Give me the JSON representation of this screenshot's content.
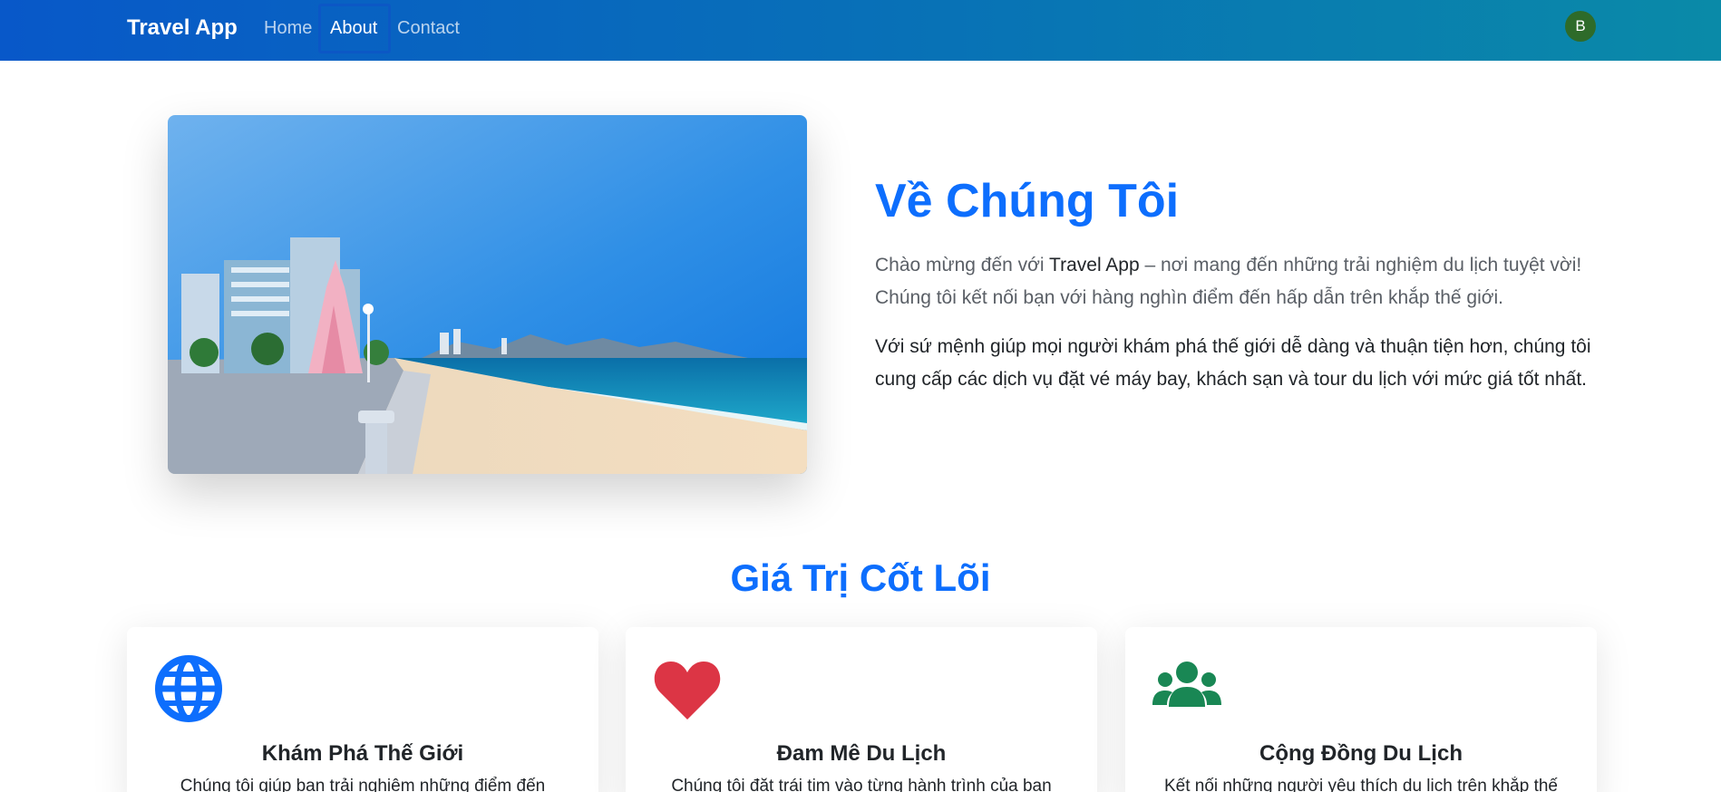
{
  "navbar": {
    "brand": "Travel App",
    "links": [
      {
        "label": "Home",
        "active": false
      },
      {
        "label": "About",
        "active": true
      },
      {
        "label": "Contact",
        "active": false
      }
    ],
    "avatar_initial": "B",
    "gradient": [
      "#0858c9",
      "#0a8aa8"
    ]
  },
  "hero": {
    "image_icon": "beach-city-photo",
    "title": "Về Chúng Tôi",
    "lead_prefix": "Chào mừng đến với ",
    "lead_app_name": "Travel App",
    "lead_suffix": " – nơi mang đến những trải nghiệm du lịch tuyệt vời! Chúng tôi kết nối bạn với hàng nghìn điểm đến hấp dẫn trên khắp thế giới.",
    "body": "Với sứ mệnh giúp mọi người khám phá thế giới dễ dàng và thuận tiện hơn, chúng tôi cung cấp các dịch vụ đặt vé máy bay, khách sạn và tour du lịch với mức giá tốt nhất."
  },
  "core_values": {
    "title": "Giá Trị Cốt Lõi",
    "cards": [
      {
        "icon": "globe-icon",
        "icon_color": "#0d6efd",
        "title": "Khám Phá Thế Giới",
        "text": "Chúng tôi giúp bạn trải nghiệm những điểm đến"
      },
      {
        "icon": "heart-icon",
        "icon_color": "#dc3545",
        "title": "Đam Mê Du Lịch",
        "text": "Chúng tôi đặt trái tim vào từng hành trình của bạn"
      },
      {
        "icon": "users-icon",
        "icon_color": "#198754",
        "title": "Cộng Đồng Du Lịch",
        "text": "Kết nối những người yêu thích du lịch trên khắp thế"
      }
    ]
  },
  "colors": {
    "primary": "#0d6efd",
    "danger": "#dc3545",
    "success": "#198754"
  }
}
